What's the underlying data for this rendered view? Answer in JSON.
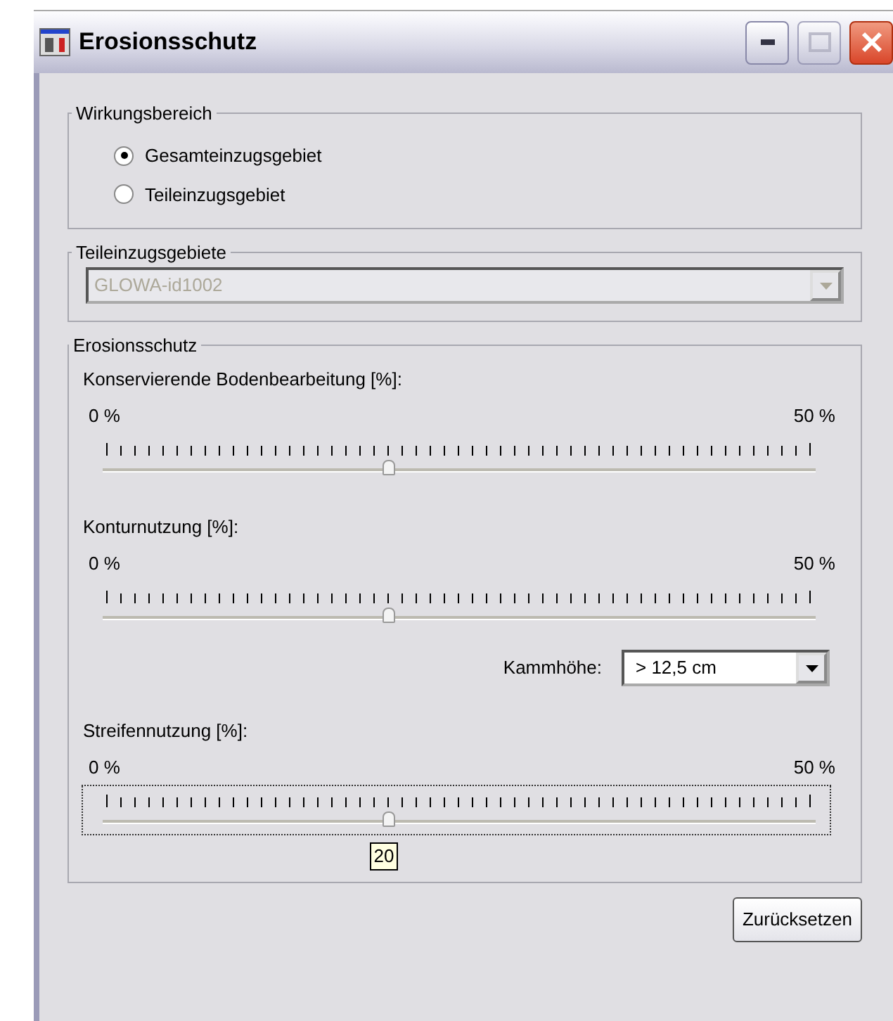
{
  "window": {
    "title": "Erosionsschutz"
  },
  "scope_group": {
    "title": "Wirkungsbereich",
    "options": [
      {
        "label": "Gesamteinzugsgebiet",
        "selected": true
      },
      {
        "label": "Teileinzugsgebiet",
        "selected": false
      }
    ]
  },
  "subcatchment_group": {
    "title": "Teileinzugsgebiete",
    "value": "GLOWA-id1002",
    "disabled": true
  },
  "erosion_group": {
    "title": "Erosionsschutz",
    "items": [
      {
        "kind": "slider",
        "label": "Konservierende Bodenbearbeitung [%]:",
        "min_label": "0 %",
        "max_label": "50 %",
        "level": 0.4,
        "focused": false
      },
      {
        "kind": "slider",
        "label": "Konturnutzung [%]:",
        "min_label": "0 %",
        "max_label": "50 %",
        "level": 0.4,
        "focused": false
      },
      {
        "kind": "combo",
        "label": "Kammhöhe:",
        "value": "> 12,5 cm"
      },
      {
        "kind": "slider",
        "label": "Streifennutzung [%]:",
        "min_label": "0 %",
        "max_label": "50 %",
        "level": 0.4,
        "focused": true,
        "tooltip": "20"
      }
    ]
  },
  "buttons": [
    {
      "label": "Zurücksetzen"
    }
  ]
}
